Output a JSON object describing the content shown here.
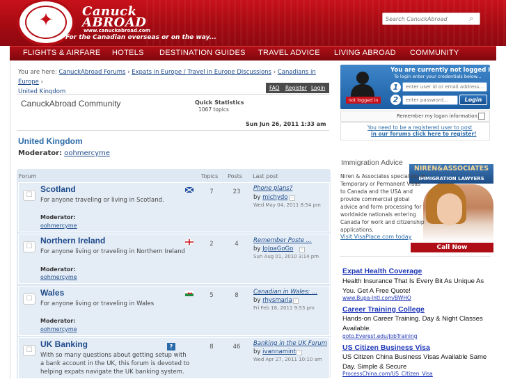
{
  "header": {
    "brand_line_1": "Canuck",
    "brand_line_2": "ABROAD",
    "brand_url": "www.canuckabroad.com",
    "tagline": "For the Canadian overseas or on the way...",
    "search_placeholder": "Search CanuckAbroad",
    "colors": {
      "primary": "#c8111a",
      "nav_dark": "#7e070d"
    }
  },
  "nav": {
    "items": [
      "FLIGHTS & AIRFARE",
      "HOTELS",
      "DESTINATION GUIDES",
      "TRAVEL ADVICE",
      "LIVING ABROAD",
      "COMMUNITY"
    ]
  },
  "breadcrumb": {
    "prefix": "You are here:",
    "items": [
      "CanuckAbroad Forums",
      "Expats in Europe / Travel in Europe Discussions",
      "Canadians in Europe",
      "United Kingdom"
    ],
    "separator": "›"
  },
  "util_links": [
    "FAQ",
    "Register",
    "Login"
  ],
  "community": {
    "title": "CanuckAbroad Community",
    "quick_stats_title": "Quick Statistics",
    "quick_stats_topics": "1067 topics",
    "date": "Sun Jun 26, 2011 1:33 am"
  },
  "forum": {
    "title": "United Kingdom",
    "moderator_label": "Moderator:",
    "moderator": "oohmercyme"
  },
  "table": {
    "headers": [
      "Forum",
      "Topics",
      "Posts",
      "Last post"
    ],
    "rows": [
      {
        "title": "Scotland",
        "desc": "For anyone traveling or living in Scotland.",
        "mod_label": "Moderator:",
        "mod": "oohmercyme",
        "flag": "scotland-flag",
        "topics": "7",
        "posts": "23",
        "last_title": "Phone plans?",
        "last_by_prefix": "by",
        "last_user": "michydo",
        "last_date": "Wed May 04, 2011 8:54 pm"
      },
      {
        "title": "Northern Ireland",
        "desc": "For anyone living or traveling in Northern Ireland",
        "mod_label": "Moderator:",
        "mod": "oohmercyme",
        "flag": "england-flag",
        "topics": "2",
        "posts": "4",
        "last_title": "Remember Poste ...",
        "last_by_prefix": "by",
        "last_user": "JoJoaGoGo",
        "last_date": "Sun Aug 01, 2010 3:14 pm"
      },
      {
        "title": "Wales",
        "desc": "For anyone living or traveling in Wales",
        "mod_label": "Moderator:",
        "mod": "oohmercyme",
        "flag": "wales-flag",
        "topics": "5",
        "posts": "8",
        "last_title": "Canadian in Wales: ...",
        "last_by_prefix": "by",
        "last_user": "rhysmaria",
        "last_date": "Fri Feb 18, 2011 9:53 pm"
      },
      {
        "title": "UK Banking",
        "desc": "With so many questions about getting setup with a bank account in the UK, this forum is devoted to helping expats navigate the UK banking system.",
        "flag": "question-icon",
        "topics": "8",
        "posts": "46",
        "last_title": "Banking in the UK Forum",
        "last_by_prefix": "by",
        "last_user": "ivannamint",
        "last_date": "Wed Apr 27, 2011 10:10 am"
      }
    ]
  },
  "login": {
    "title": "You are currently not logged in!",
    "subtitle": "To login enter your credentials below...",
    "badge": "not logged in",
    "user_placeholder": "enter user id or email address...",
    "pass_placeholder": "enter password...",
    "button": "Login",
    "remember": "Remember my logon information",
    "register_line_1": "You need to be a registered user to post",
    "register_line_2": "in our forums click here to register!",
    "step_1": "1",
    "step_2": "2"
  },
  "immigration": {
    "heading": "Immigration Advice",
    "text": "Niren & Associates specializes in Temporary or Permanent Visas to Canada and the USA and provide commercial global advice and form processing for worldwide nationals entering Canada for work and citizenship applications.",
    "link": "Visit VisaPlace.com today",
    "banner_title": "NIREN&ASSOCIATES",
    "banner_sub": "IMMIGRATION LAWYERS",
    "phone": "Call Now 1.866.929.0991"
  },
  "ads": [
    {
      "title": "Expat Health Coverage",
      "text": "Health Insurance That Is Every Bit As Unique As You. Get A Free Quote!",
      "url": "www.Bupa-Intl.com/BWHO"
    },
    {
      "title": "Career Training College",
      "text": "Hands-on Career Training. Day & Night Classes Available.",
      "url": "goto.Everest.edu/JobTraining"
    },
    {
      "title": "US Citizen Business Visa",
      "text": "US Citizen China Business Visas Available Same Day. Simple & Secure",
      "url": "ProcessChina.com/US_Citizen_Visa"
    }
  ]
}
